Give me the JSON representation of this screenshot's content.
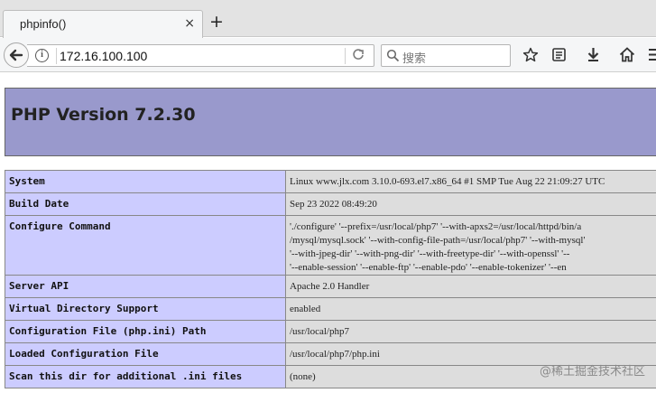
{
  "browser": {
    "tab_title": "phpinfo()",
    "tab_close": "×",
    "new_tab": "+",
    "url": "172.16.100.100",
    "search_placeholder": "搜索"
  },
  "page": {
    "heading": "PHP Version 7.2.30",
    "rows": [
      {
        "key": "System",
        "value": [
          "Linux www.jlx.com 3.10.0-693.el7.x86_64 #1 SMP Tue Aug 22 21:09:27 UTC"
        ]
      },
      {
        "key": "Build Date",
        "value": [
          "Sep 23 2022 08:49:20"
        ]
      },
      {
        "key": "Configure Command",
        "value": [
          "'./configure' '--prefix=/usr/local/php7' '--with-apxs2=/usr/local/httpd/bin/a",
          "/mysql/mysql.sock' '--with-config-file-path=/usr/local/php7' '--with-mysql'",
          "'--with-jpeg-dir' '--with-png-dir' '--with-freetype-dir' '--with-openssl' '--",
          "'--enable-session' '--enable-ftp' '--enable-pdo' '--enable-tokenizer' '--en"
        ]
      },
      {
        "key": "Server API",
        "value": [
          "Apache 2.0 Handler"
        ]
      },
      {
        "key": "Virtual Directory Support",
        "value": [
          "enabled"
        ]
      },
      {
        "key": "Configuration File (php.ini) Path",
        "value": [
          "/usr/local/php7"
        ]
      },
      {
        "key": "Loaded Configuration File",
        "value": [
          "/usr/local/php7/php.ini"
        ]
      },
      {
        "key": "Scan this dir for additional .ini files",
        "value": [
          "(none)"
        ]
      }
    ]
  },
  "watermark": "@稀土掘金技术社区",
  "colors": {
    "header_bg": "#9999cc",
    "key_bg": "#ccccff",
    "value_bg": "#dddddd"
  },
  "icons": [
    "back-arrow-icon",
    "info-icon",
    "reload-icon",
    "search-icon",
    "bookmark-star-icon",
    "reading-list-icon",
    "download-icon",
    "home-icon",
    "menu-icon"
  ]
}
